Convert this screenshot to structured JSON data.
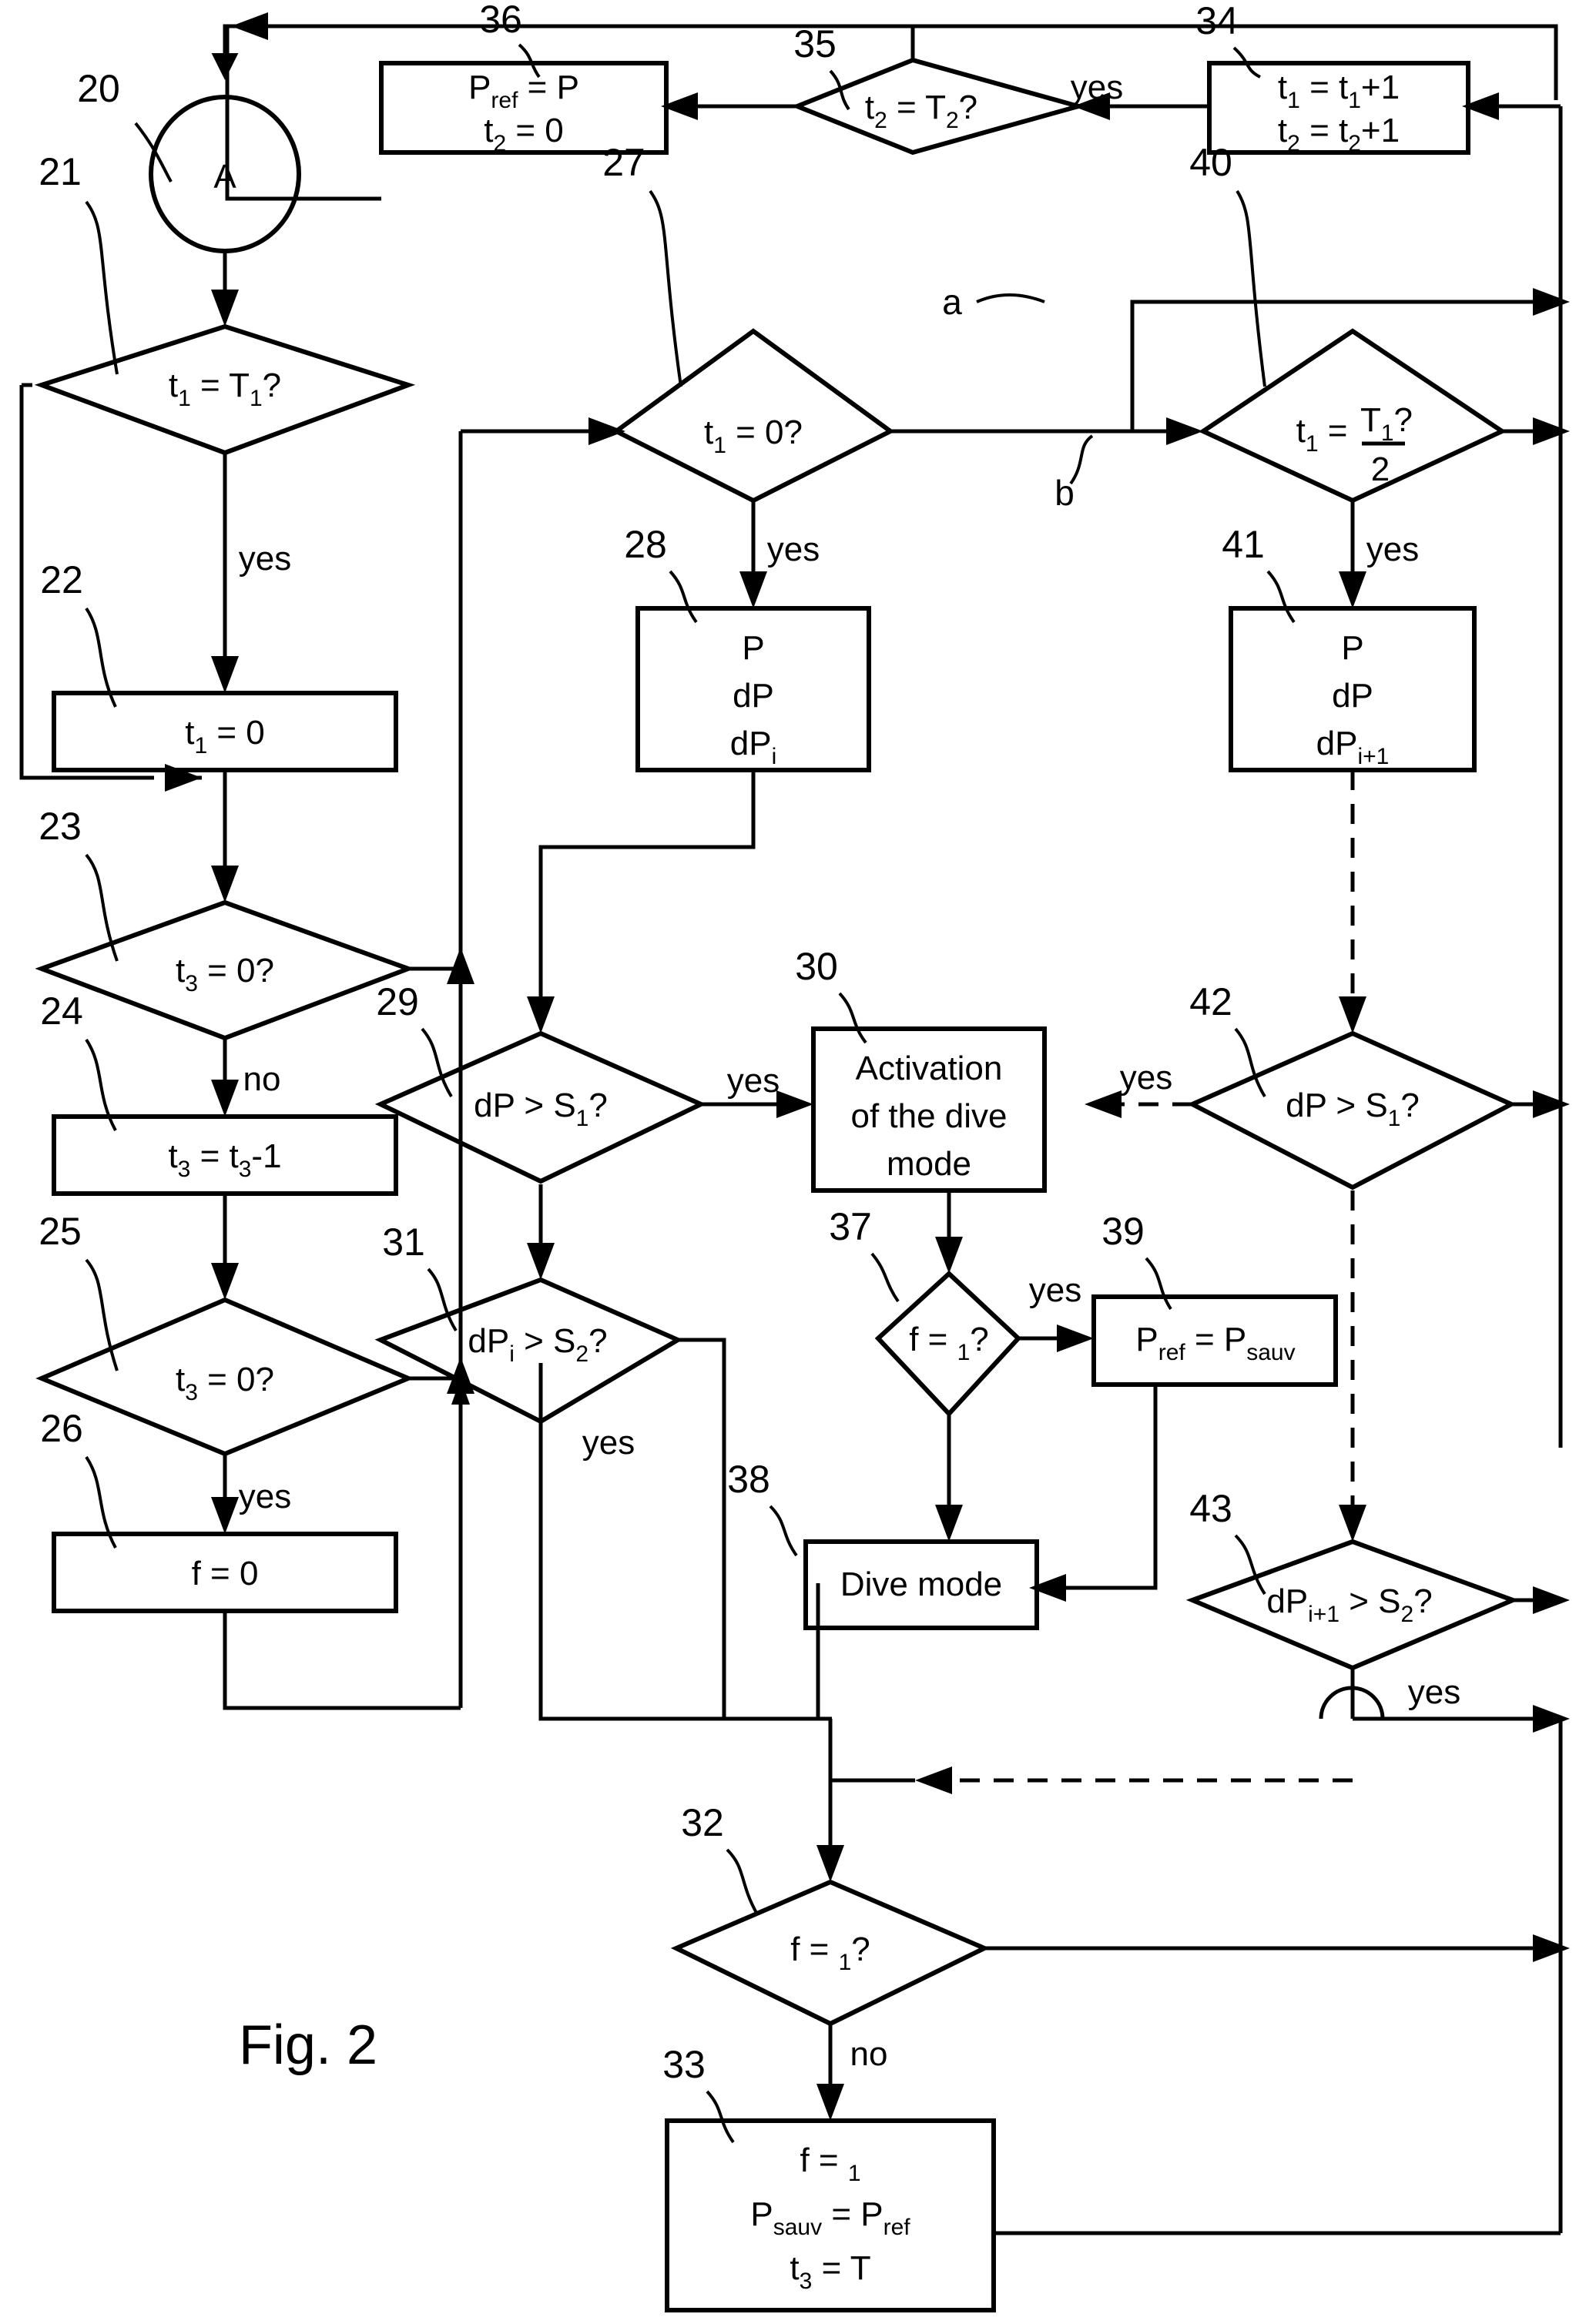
{
  "figure": {
    "caption": "Fig. 2",
    "type": "patent-flowchart"
  },
  "labels": {
    "yes": "yes",
    "no": "no",
    "branch_a": "a",
    "branch_b": "b"
  },
  "nodes": [
    {
      "ref": "20",
      "kind": "connector",
      "text": "A"
    },
    {
      "ref": "21",
      "kind": "decision",
      "text": "t1 = T1?",
      "html": "t<tspan class='sub' dy='12'>1</tspan><tspan dy='-12'> = T</tspan><tspan class='sub' dy='12'>1</tspan><tspan dy='-12'>?</tspan>"
    },
    {
      "ref": "22",
      "kind": "process",
      "text": "t1 = 0"
    },
    {
      "ref": "23",
      "kind": "decision",
      "text": "t3 = 0?"
    },
    {
      "ref": "24",
      "kind": "process",
      "text": "t3 = t3-1"
    },
    {
      "ref": "25",
      "kind": "decision",
      "text": "t3 = 0?"
    },
    {
      "ref": "26",
      "kind": "process",
      "text": "f = 0"
    },
    {
      "ref": "27",
      "kind": "decision",
      "text": "t1 = 0?"
    },
    {
      "ref": "28",
      "kind": "process",
      "lines": [
        "P",
        "dP",
        "dPi"
      ]
    },
    {
      "ref": "29",
      "kind": "decision",
      "text": "dP > S1?"
    },
    {
      "ref": "30",
      "kind": "process",
      "lines": [
        "Activation",
        "of the dive",
        "mode"
      ]
    },
    {
      "ref": "31",
      "kind": "decision",
      "text": "dPi > S2?"
    },
    {
      "ref": "32",
      "kind": "decision",
      "text": "f = 1?"
    },
    {
      "ref": "33",
      "kind": "process",
      "lines": [
        "f = 1",
        "Psauv = Pref",
        "t3 = T"
      ]
    },
    {
      "ref": "34",
      "kind": "process",
      "lines": [
        "t1 = t1+1",
        "t2 = t2+1"
      ]
    },
    {
      "ref": "35",
      "kind": "decision",
      "text": "t2 = T2?"
    },
    {
      "ref": "36",
      "kind": "process",
      "lines": [
        "Pref = P",
        "t2 = 0"
      ]
    },
    {
      "ref": "37",
      "kind": "decision",
      "text": "f = 1?"
    },
    {
      "ref": "38",
      "kind": "process",
      "text": "Dive mode"
    },
    {
      "ref": "39",
      "kind": "process",
      "text": "Pref = Psauv"
    },
    {
      "ref": "40",
      "kind": "decision",
      "text": "t1 = T1/2?"
    },
    {
      "ref": "41",
      "kind": "process",
      "lines": [
        "P",
        "dP",
        "dPi+1"
      ]
    },
    {
      "ref": "42",
      "kind": "decision",
      "text": "dP > S1?"
    },
    {
      "ref": "43",
      "kind": "decision",
      "text": "dPi+1 > S2?"
    }
  ],
  "refs": {
    "n20": "20",
    "n21": "21",
    "n22": "22",
    "n23": "23",
    "n24": "24",
    "n25": "25",
    "n26": "26",
    "n27": "27",
    "n28": "28",
    "n29": "29",
    "n30": "30",
    "n31": "31",
    "n32": "32",
    "n33": "33",
    "n34": "34",
    "n35": "35",
    "n36": "36",
    "n37": "37",
    "n38": "38",
    "n39": "39",
    "n40": "40",
    "n41": "41",
    "n42": "42",
    "n43": "43"
  },
  "text": {
    "connector_a": "A",
    "dive_mode": "Dive mode",
    "activation_l1": "Activation",
    "activation_l2": "of the dive",
    "activation_l3": "mode",
    "P": "P",
    "dP": "dP",
    "T": "T",
    "one": "1",
    "two": "2",
    "zero": "0"
  },
  "colors": {
    "stroke": "#000000",
    "background": "#ffffff"
  }
}
